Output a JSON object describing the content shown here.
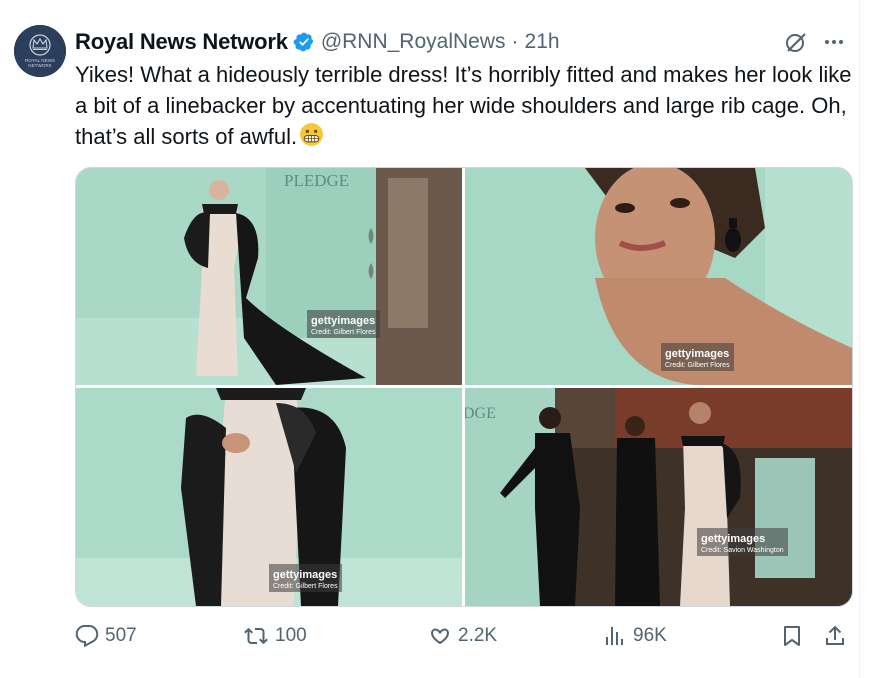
{
  "tweet": {
    "author_name": "Royal News Network",
    "handle": "@RNN_RoyalNews",
    "separator": "·",
    "time": "21h",
    "text": "Yikes! What a hideously terrible dress! It’s horribly fitted and makes her look like a bit of a linebacker by accentuating her wide shoulders and large rib cage. Oh, that’s all sorts of awful.",
    "emoji": "grimacing-face",
    "avatar_text_line1": "ROYAL NEWS",
    "avatar_text_line2": "NETWORK"
  },
  "media": {
    "photos": [
      {
        "brand_bold": "getty",
        "brand": "images",
        "credit": "Credit: Gilbert Flores",
        "sign_text": "PLEDGE"
      },
      {
        "brand_bold": "getty",
        "brand": "images",
        "credit": "Credit: Gilbert Flores"
      },
      {
        "brand_bold": "getty",
        "brand": "images",
        "credit": "Credit: Gilbert Flores"
      },
      {
        "brand_bold": "getty",
        "brand": "images",
        "credit": "Credit: Savion Washington",
        "sign_text": "DGE"
      }
    ]
  },
  "actions": {
    "replies": "507",
    "reposts": "100",
    "likes": "2.2K",
    "views": "96K"
  },
  "colors": {
    "verified": "#1d9bf0",
    "secondary_text": "#536471",
    "backdrop_green": "#a9d9c8"
  }
}
